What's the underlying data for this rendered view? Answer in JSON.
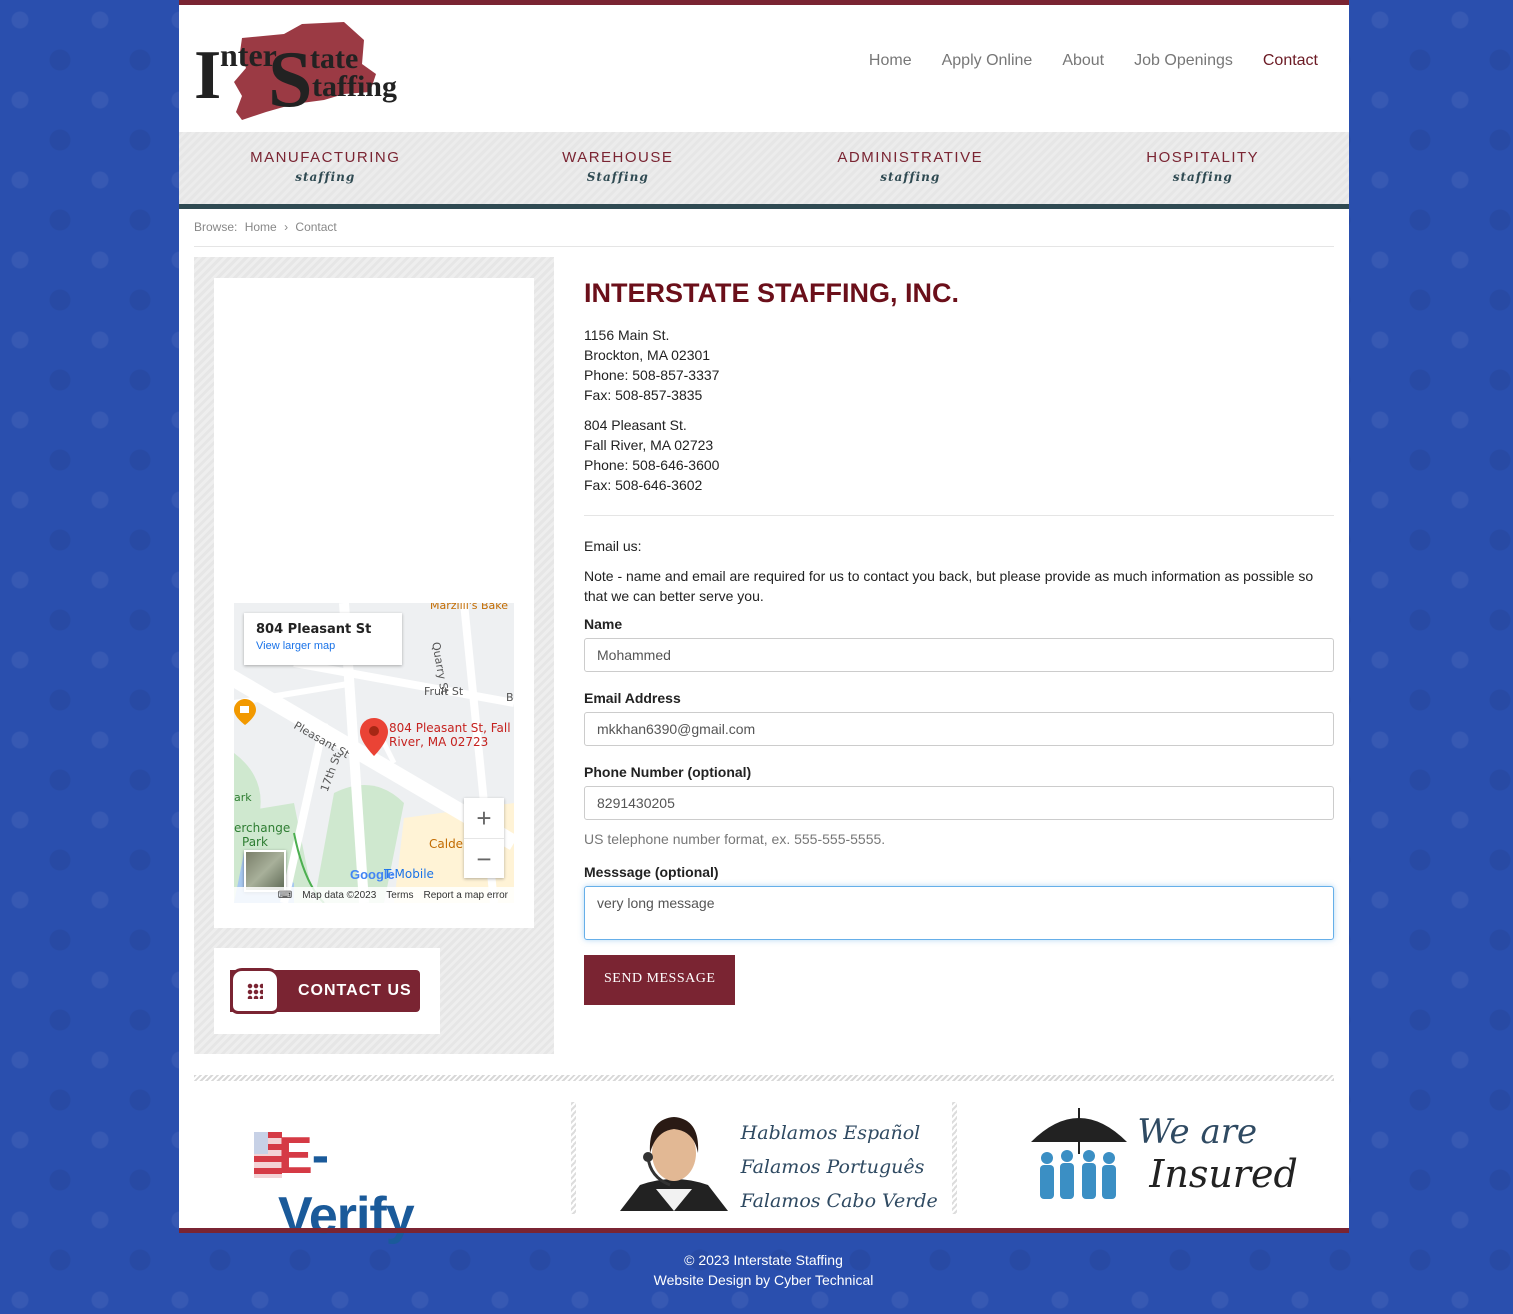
{
  "brand": {
    "name_line1": "Inter",
    "name_big_s": "S",
    "name_line1b": "tate",
    "name_line2": "taffing",
    "accent": "#7a2432"
  },
  "nav": [
    {
      "label": "Home"
    },
    {
      "label": "Apply Online"
    },
    {
      "label": "About"
    },
    {
      "label": "Job Openings"
    },
    {
      "label": "Contact",
      "active": true
    }
  ],
  "categories": [
    {
      "title": "MANUFACTURING",
      "sub": "staffing"
    },
    {
      "title": "WAREHOUSE",
      "sub": "Staffing"
    },
    {
      "title": "ADMINISTRATIVE",
      "sub": "staffing"
    },
    {
      "title": "HOSPITALITY",
      "sub": "staffing"
    }
  ],
  "breadcrumb": {
    "prefix": "Browse:",
    "home": "Home",
    "sep": "›",
    "current": "Contact"
  },
  "map": {
    "card_title": "804 Pleasant St",
    "card_link": "View larger map",
    "pin_label_1": "804 Pleasant St, Fall",
    "pin_label_2": "River, MA 02723",
    "streets": [
      "Marzilli's Bake",
      "Quarry St",
      "Fruit St",
      "Pleasant St",
      "17th St",
      "ark",
      "erchange",
      "Park",
      "Calde",
      "T-Mobile",
      "B"
    ],
    "zoom_in": "+",
    "zoom_out": "−",
    "footer": [
      "Map data ©2023",
      "Terms",
      "Report a map error"
    ],
    "google": "Google"
  },
  "contact_us_label": "CONTACT US",
  "company": "INTERSTATE STAFFING, INC.",
  "office1": [
    "1156 Main St.",
    "Brockton, MA 02301",
    "Phone: 508-857-3337",
    "Fax: 508-857-3835"
  ],
  "office2": [
    "804 Pleasant St.",
    "Fall River, MA 02723",
    "Phone: 508-646-3600",
    "Fax: 508-646-3602"
  ],
  "email_us": "Email us:",
  "note": "Note - name and email are required for us to contact you back, but please provide as much information as possible so that we can better serve you.",
  "form": {
    "name_label": "Name",
    "name_value": "Mohammed",
    "email_label": "Email Address",
    "email_value": "mkkhan6390@gmail.com",
    "phone_label": "Phone Number (optional)",
    "phone_value": "8291430205",
    "phone_help": "US telephone number format, ex. 555-555-5555.",
    "message_label": "Messsage (optional)",
    "message_value": "very long message",
    "submit": "SEND MESSAGE"
  },
  "badges": {
    "everify_e": "E",
    "everify_rest": "-Verify",
    "languages": [
      "Hablamos Español",
      "Falamos Português",
      "Falamos Cabo Verde"
    ],
    "insured_1": "We are",
    "insured_2": "Insured"
  },
  "footer": {
    "copyright": "© 2023 Interstate Staffing",
    "credit": "Website Design by Cyber Technical"
  }
}
